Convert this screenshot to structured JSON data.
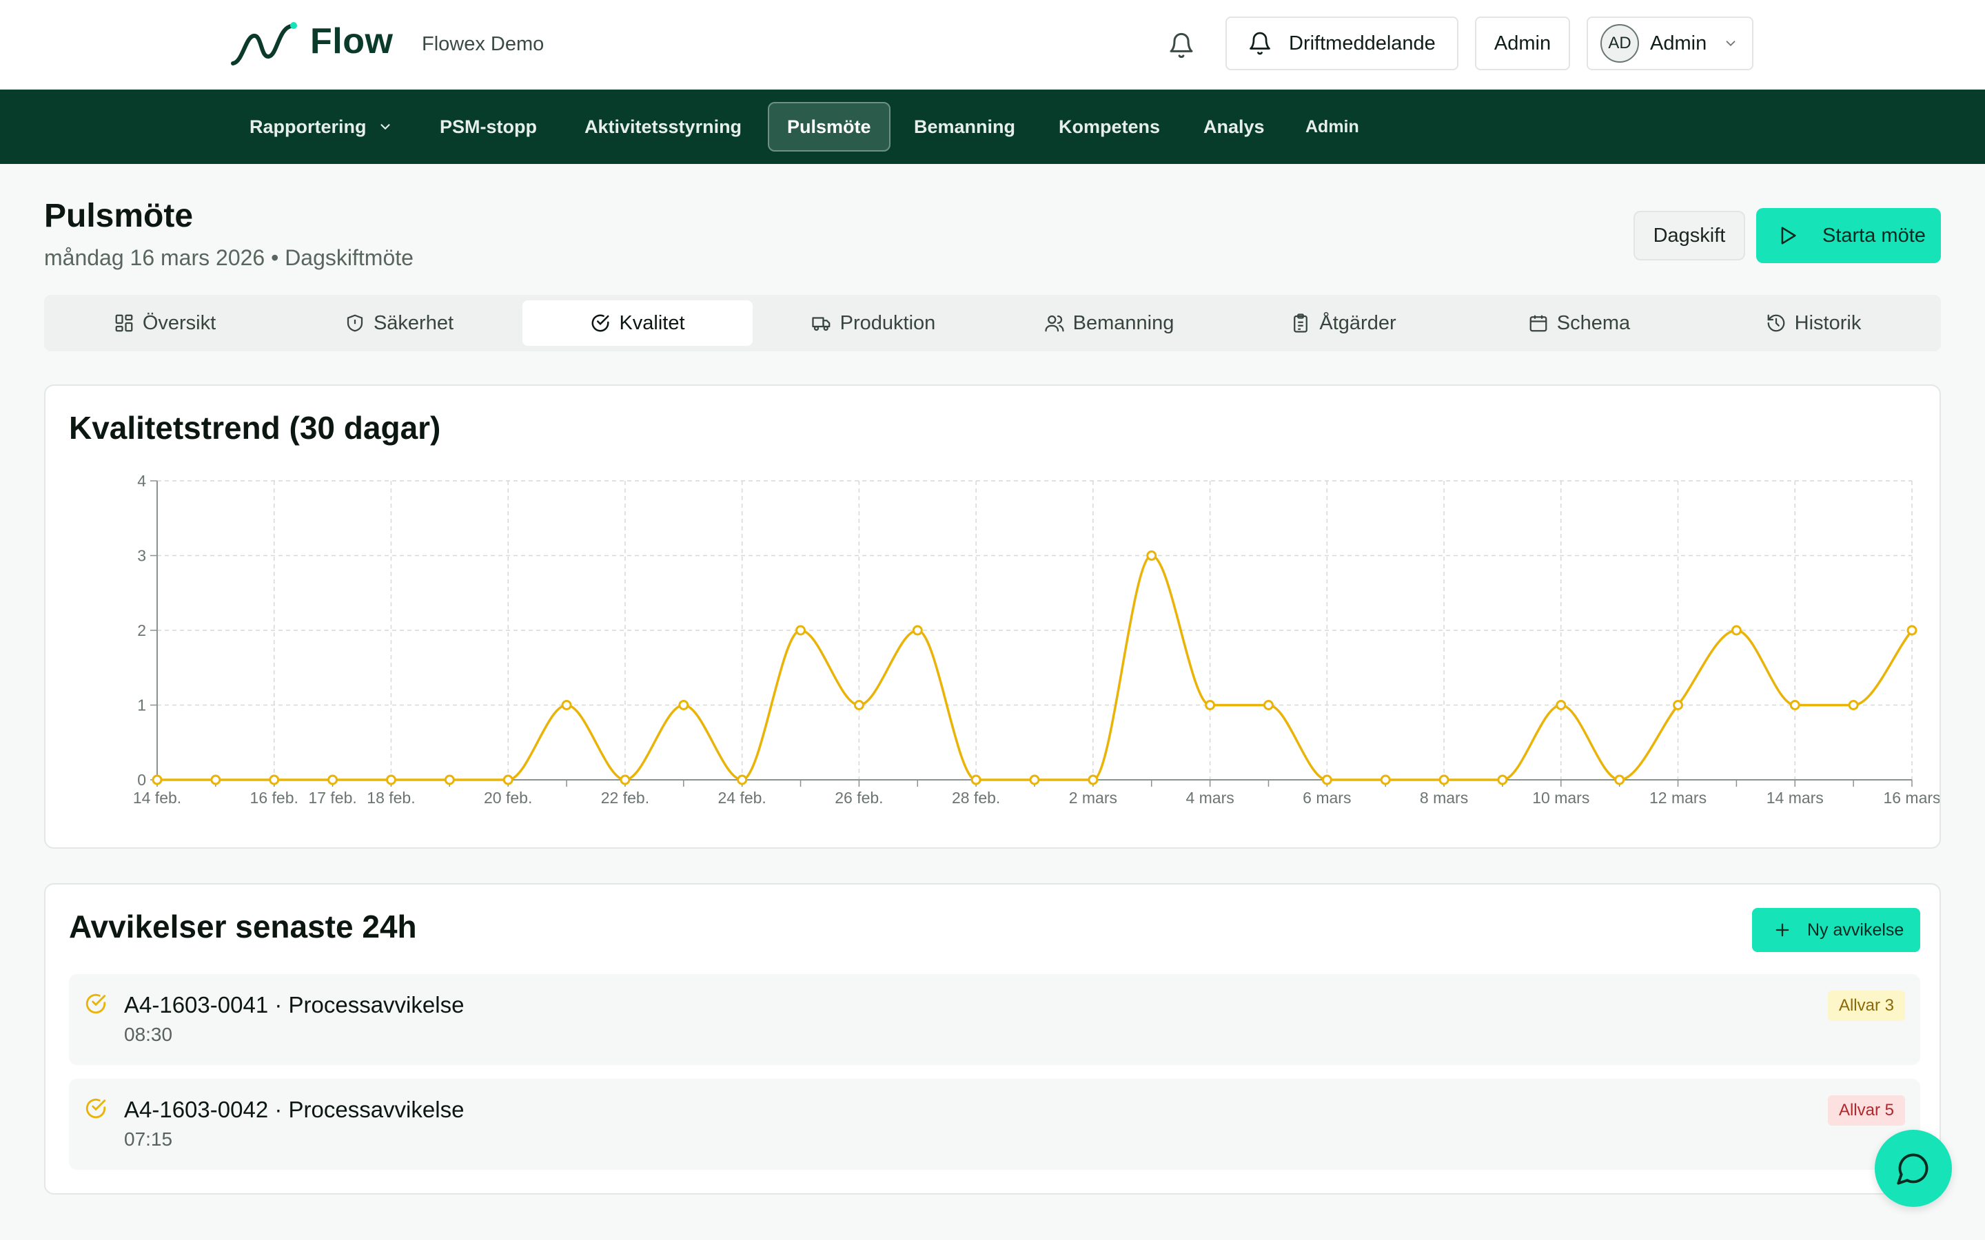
{
  "header": {
    "brand": "Flow",
    "org": "Flowex Demo",
    "drift_label": "Driftmeddelande",
    "admin_label": "Admin",
    "user_initials": "AD",
    "user_name": "Admin"
  },
  "nav": {
    "items": [
      "Rapportering",
      "PSM-stopp",
      "Aktivitetsstyrning",
      "Pulsmöte",
      "Bemanning",
      "Kompetens",
      "Analys",
      "Admin"
    ],
    "active": "Pulsmöte"
  },
  "page": {
    "title": "Pulsmöte",
    "subtitle": "måndag 16 mars 2026 • Dagskiftmöte",
    "shift_label": "Dagskift",
    "start_label": "Starta möte"
  },
  "tabs": {
    "items": [
      "Översikt",
      "Säkerhet",
      "Kvalitet",
      "Produktion",
      "Bemanning",
      "Åtgärder",
      "Schema",
      "Historik"
    ],
    "active": "Kvalitet"
  },
  "quality_card": {
    "title": "Kvalitetstrend (30 dagar)"
  },
  "chart_data": {
    "type": "line",
    "title": "Kvalitetstrend (30 dagar)",
    "x": [
      "14 feb.",
      "15 feb.",
      "16 feb.",
      "17 feb.",
      "18 feb.",
      "19 feb.",
      "20 feb.",
      "21 feb.",
      "22 feb.",
      "23 feb.",
      "24 feb.",
      "25 feb.",
      "26 feb.",
      "27 feb.",
      "28 feb.",
      "1 mars",
      "2 mars",
      "3 mars",
      "4 mars",
      "5 mars",
      "6 mars",
      "7 mars",
      "8 mars",
      "9 mars",
      "10 mars",
      "11 mars",
      "12 mars",
      "13 mars",
      "14 mars",
      "15 mars",
      "16 mars"
    ],
    "values": [
      0,
      0,
      0,
      0,
      0,
      0,
      0,
      1,
      0,
      1,
      0,
      2,
      1,
      2,
      0,
      0,
      0,
      3,
      1,
      1,
      0,
      0,
      0,
      0,
      1,
      0,
      1,
      2,
      1,
      1,
      2
    ],
    "tick_labels": {
      "0": "14 feb.",
      "2": "16 feb.",
      "3": "17 feb.",
      "4": "18 feb.",
      "6": "20 feb.",
      "8": "22 feb.",
      "10": "24 feb.",
      "12": "26 feb.",
      "14": "28 feb.",
      "16": "2 mars",
      "18": "4 mars",
      "20": "6 mars",
      "22": "8 mars",
      "24": "10 mars",
      "26": "12 mars",
      "28": "14 mars",
      "30": "16 mars"
    },
    "yticks": [
      0,
      1,
      2,
      3,
      4
    ],
    "ylim": [
      0,
      4
    ],
    "grid": true,
    "line_color": "#eab308"
  },
  "deviations": {
    "title": "Avvikelser senaste 24h",
    "new_label": "Ny avvikelse",
    "items": [
      {
        "title": "A4-1603-0041 · Processavvikelse",
        "time": "08:30",
        "severity": "Allvar 3",
        "level": "warn"
      },
      {
        "title": "A4-1603-0042 · Processavvikelse",
        "time": "07:15",
        "severity": "Allvar 5",
        "level": "danger"
      }
    ]
  },
  "colors": {
    "brand": "#073b2a",
    "accent": "#17e3b9",
    "series": "#eab308"
  }
}
